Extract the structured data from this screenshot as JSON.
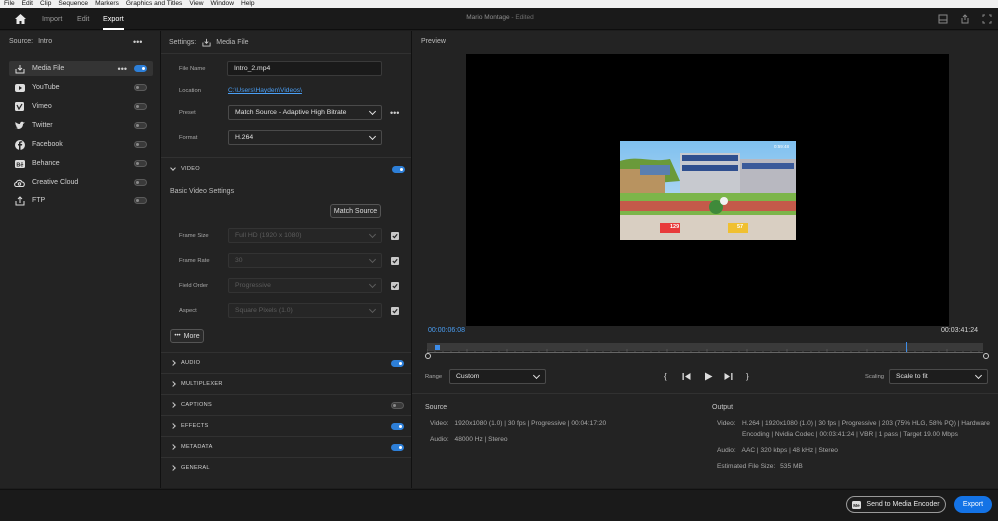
{
  "menubar": {
    "items": [
      "File",
      "Edit",
      "Clip",
      "Sequence",
      "Markers",
      "Graphics and Titles",
      "View",
      "Window",
      "Help"
    ]
  },
  "header": {
    "tabs": [
      "Import",
      "Edit",
      "Export"
    ],
    "active_tab": "Export",
    "project_title": "Mario Montage",
    "edited_status": "- Edited"
  },
  "source": {
    "label": "Source:",
    "name": "Intro",
    "menu": "•••"
  },
  "destinations": [
    {
      "label": "Media File",
      "icon": "download-icon",
      "enabled": true
    },
    {
      "label": "YouTube",
      "icon": "youtube-icon",
      "enabled": false
    },
    {
      "label": "Vimeo",
      "icon": "vimeo-icon",
      "enabled": false
    },
    {
      "label": "Twitter",
      "icon": "twitter-icon",
      "enabled": false
    },
    {
      "label": "Facebook",
      "icon": "facebook-icon",
      "enabled": false
    },
    {
      "label": "Behance",
      "icon": "behance-icon",
      "enabled": false
    },
    {
      "label": "Creative Cloud",
      "icon": "creative-cloud-icon",
      "enabled": false
    },
    {
      "label": "FTP",
      "icon": "ftp-upload-icon",
      "enabled": false
    }
  ],
  "settings": {
    "header_label": "Settings:",
    "header_value": "Media File",
    "file_name_label": "File Name",
    "file_name_value": "Intro_2.mp4",
    "location_label": "Location",
    "location_value": "C:\\Users\\Hayden\\Videos\\",
    "preset_label": "Preset",
    "preset_value": "Match Source - Adaptive High Bitrate",
    "format_label": "Format",
    "format_value": "H.264",
    "more_menu": "•••"
  },
  "video": {
    "section": "VIDEO",
    "enabled": true,
    "basic_title": "Basic Video Settings",
    "match_source_button": "Match Source",
    "rows": [
      {
        "label": "Frame Size",
        "value": "Full HD (1920 x 1080)",
        "checked": true
      },
      {
        "label": "Frame Rate",
        "value": "30",
        "checked": true
      },
      {
        "label": "Field Order",
        "value": "Progressive",
        "checked": true
      },
      {
        "label": "Aspect",
        "value": "Square Pixels (1.0)",
        "checked": true
      }
    ],
    "more_button": "More",
    "more_dots": "•••"
  },
  "sections": [
    {
      "name": "AUDIO",
      "toggle": "on"
    },
    {
      "name": "MULTIPLEXER",
      "toggle": "none"
    },
    {
      "name": "CAPTIONS",
      "toggle": "off"
    },
    {
      "name": "EFFECTS",
      "toggle": "on"
    },
    {
      "name": "METADATA",
      "toggle": "on"
    },
    {
      "name": "GENERAL",
      "toggle": "none"
    }
  ],
  "preview": {
    "label": "Preview",
    "current_time": "00:00:06:08",
    "duration": "00:03:41:24",
    "playhead_fraction": 0.018,
    "range_label": "Range",
    "range_value": "Custom",
    "scaling_label": "Scaling",
    "scaling_value": "Scale to fit",
    "thumb_text_top": "0:59:48",
    "thumb_pct_1": "129",
    "thumb_pct_2": "57"
  },
  "source_info": {
    "heading": "Source",
    "video_label": "Video:",
    "video_value": "1920x1080 (1.0)  |  30 fps  |  Progressive  |  00:04:17:20",
    "audio_label": "Audio:",
    "audio_value": "48000 Hz  |  Stereo"
  },
  "output_info": {
    "heading": "Output",
    "video_label": "Video:",
    "video_line1": "H.264  |  1920x1080 (1.0)  |  30 fps  |  Progressive  |  203 (75% HLG, 58% PQ)  |  Hardware",
    "video_line2": "Encoding  |  Nvidia Codec  |  00:03:41:24  |  VBR  |  1 pass  |  Target 19.00 Mbps",
    "audio_label": "Audio:",
    "audio_value": "AAC  |  320 kbps  |  48 kHz  |  Stereo",
    "size_label": "Estimated File Size:",
    "size_value": "535 MB"
  },
  "footer": {
    "send_button": "Send to Media Encoder",
    "export_button": "Export"
  },
  "colors": {
    "accent": "#1473e6",
    "toggle_on": "#2d7fd8",
    "link": "#4a9ff5",
    "timecode": "#4a9ff5"
  }
}
